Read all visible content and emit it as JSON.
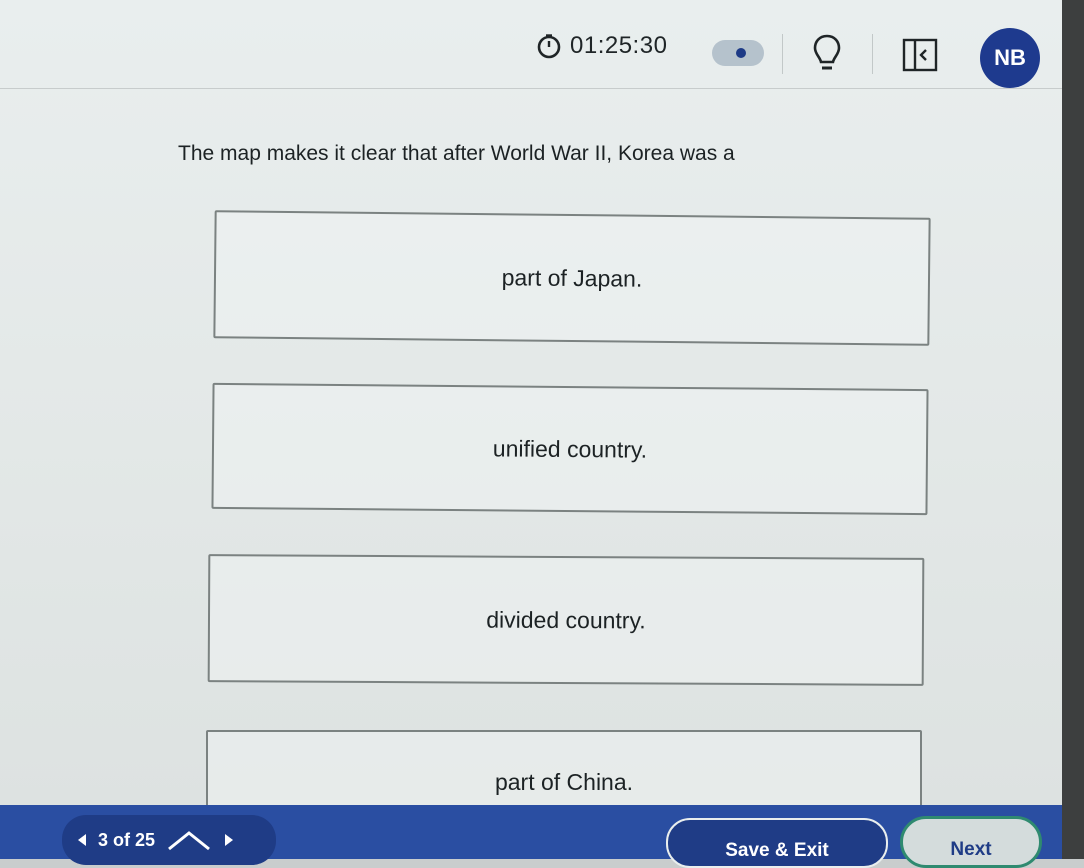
{
  "topbar": {
    "timer": "01:25:30",
    "user_initials": "NB"
  },
  "question": {
    "text": "The map makes it clear that after World War II, Korea was a"
  },
  "choices": [
    {
      "label": "part of Japan."
    },
    {
      "label": "unified country."
    },
    {
      "label": "divided country."
    },
    {
      "label": "part of China."
    }
  ],
  "footer": {
    "counter": "3 of 25",
    "save_label": "Save & Exit",
    "next_label": "Next"
  },
  "colors": {
    "brand_blue": "#2a4ea2",
    "avatar_blue": "#1e3a8e",
    "next_border": "#2f8a70"
  },
  "icons": [
    "timer-icon",
    "toggle-switch",
    "lightbulb-icon",
    "collapse-panel-icon",
    "chevron-left-icon",
    "chevron-up-icon",
    "chevron-right-icon"
  ]
}
